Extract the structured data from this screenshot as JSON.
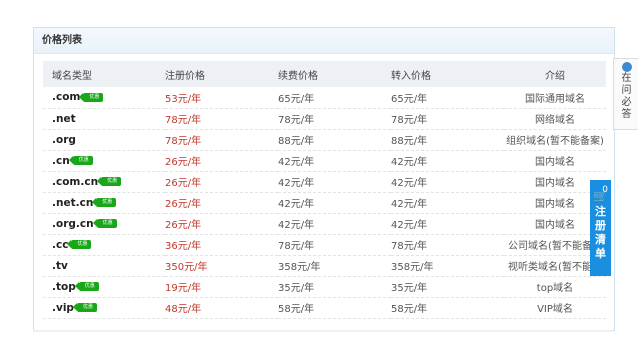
{
  "panel": {
    "title": "价格列表"
  },
  "table": {
    "headers": [
      "域名类型",
      "注册价格",
      "续费价格",
      "转入价格",
      "介绍"
    ],
    "tag_text": "优惠",
    "rows": [
      {
        "domain": ".com",
        "reg": "53元/年",
        "renew": "65元/年",
        "transfer": "65元/年",
        "intro": "国际通用域名",
        "tag": true
      },
      {
        "domain": ".net",
        "reg": "78元/年",
        "renew": "78元/年",
        "transfer": "78元/年",
        "intro": "网络域名",
        "tag": false
      },
      {
        "domain": ".org",
        "reg": "78元/年",
        "renew": "88元/年",
        "transfer": "88元/年",
        "intro": "组织域名(暂不能备案)",
        "tag": false
      },
      {
        "domain": ".cn",
        "reg": "26元/年",
        "renew": "42元/年",
        "transfer": "42元/年",
        "intro": "国内域名",
        "tag": true
      },
      {
        "domain": ".com.cn",
        "reg": "26元/年",
        "renew": "42元/年",
        "transfer": "42元/年",
        "intro": "国内域名",
        "tag": true
      },
      {
        "domain": ".net.cn",
        "reg": "26元/年",
        "renew": "42元/年",
        "transfer": "42元/年",
        "intro": "国内域名",
        "tag": true
      },
      {
        "domain": ".org.cn",
        "reg": "26元/年",
        "renew": "42元/年",
        "transfer": "42元/年",
        "intro": "国内域名",
        "tag": true
      },
      {
        "domain": ".cc",
        "reg": "36元/年",
        "renew": "78元/年",
        "transfer": "78元/年",
        "intro": "公司域名(暂不能备案",
        "tag": true
      },
      {
        "domain": ".tv",
        "reg": "350元/年",
        "renew": "358元/年",
        "transfer": "358元/年",
        "intro": "视听类域名(暂不能备",
        "tag": false
      },
      {
        "domain": ".top",
        "reg": "19元/年",
        "renew": "35元/年",
        "transfer": "35元/年",
        "intro": "top域名",
        "tag": true
      },
      {
        "domain": ".vip",
        "reg": "48元/年",
        "renew": "58元/年",
        "transfer": "58元/年",
        "intro": "VIP域名",
        "tag": true
      }
    ]
  },
  "cart": {
    "count": "0",
    "label_chars": [
      "注",
      "册",
      "清",
      "单"
    ],
    "icon": "cart-icon"
  },
  "float_panel": {
    "chars": [
      "在",
      "问",
      "必",
      "答"
    ]
  },
  "colors": {
    "price_red": "#c0392b",
    "tag_green": "#19a719",
    "cart_blue": "#1a8fe0"
  }
}
